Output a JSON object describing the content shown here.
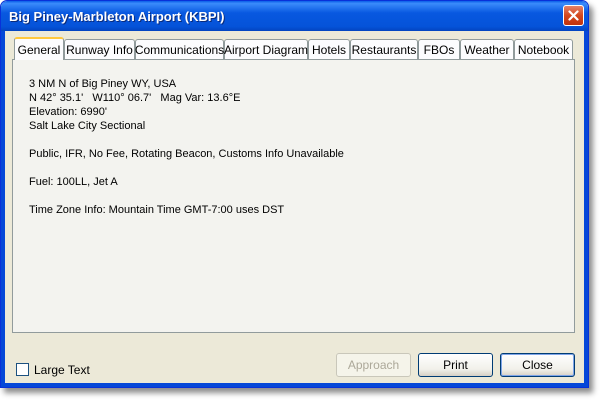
{
  "window": {
    "title": "Big Piney-Marbleton Airport (KBPI)"
  },
  "tabs": [
    {
      "label": "General"
    },
    {
      "label": "Runway Info"
    },
    {
      "label": "Communications"
    },
    {
      "label": "Airport Diagram"
    },
    {
      "label": "Hotels"
    },
    {
      "label": "Restaurants"
    },
    {
      "label": "FBOs"
    },
    {
      "label": "Weather"
    },
    {
      "label": "Notebook"
    }
  ],
  "general": {
    "location": "3 NM N of Big Piney WY, USA",
    "coordinates": "N 42° 35.1'   W110° 06.7'   Mag Var: 13.6°E",
    "elevation": "Elevation: 6990'",
    "sectional": "Salt Lake City Sectional",
    "attributes": "Public, IFR, No Fee, Rotating Beacon, Customs Info Unavailable",
    "fuel": "Fuel: 100LL, Jet A",
    "timezone": "Time Zone Info: Mountain Time GMT-7:00 uses DST"
  },
  "footer": {
    "large_text_label": "Large Text",
    "large_text_checked": false,
    "approach_label": "Approach",
    "print_label": "Print",
    "close_label": "Close"
  }
}
